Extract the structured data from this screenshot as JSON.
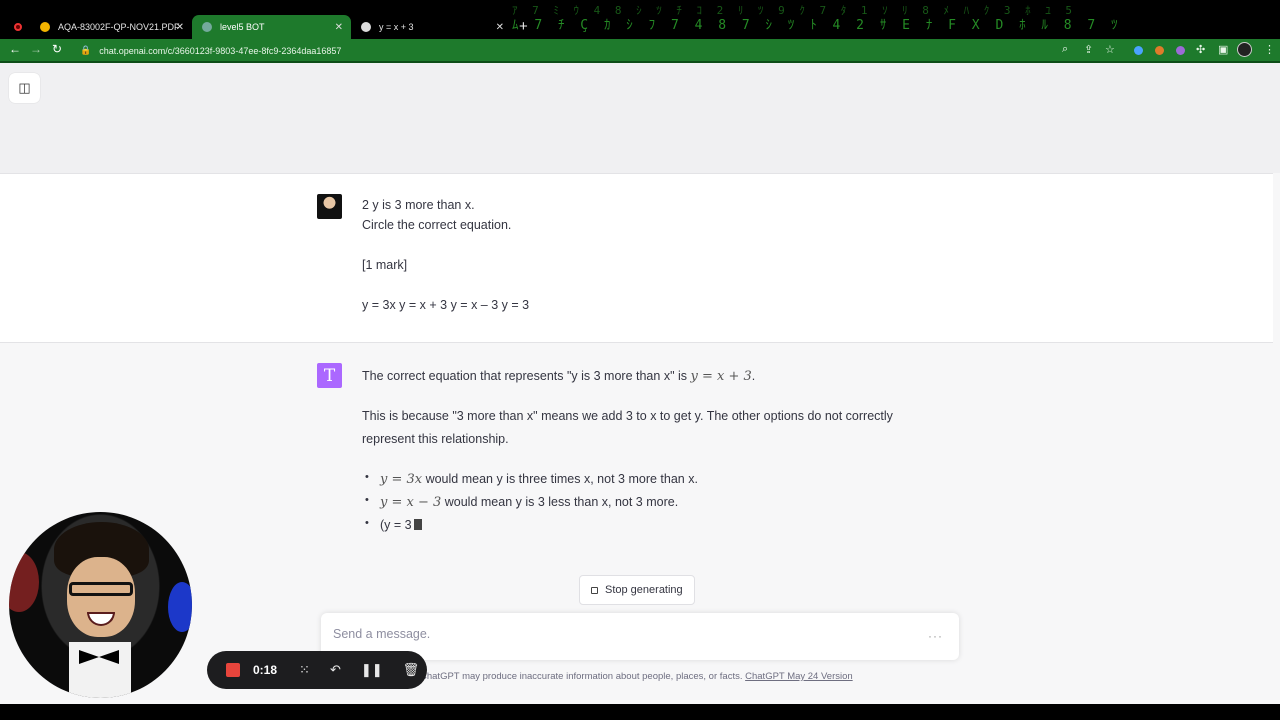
{
  "tabs": [
    {
      "label": "AQA-83002F-QP-NOV21.PDF",
      "active": false
    },
    {
      "label": "level5 BOT",
      "active": true
    },
    {
      "label": "y = x + 3",
      "active": false
    }
  ],
  "toolbar": {
    "url": "chat.openai.com/c/3660123f-9803-47ee-8fc9-2364daa16857"
  },
  "icons": {
    "back": "arrow-left-icon",
    "forward": "arrow-right-icon",
    "reload": "reload-icon",
    "sidebar_toggle": "sidebar-icon",
    "stop": "stop-square-icon"
  },
  "conversation": {
    "user_message": {
      "line1": "2 y is 3 more than x.",
      "line2": "Circle the correct equation.",
      "line3": "[1 mark]",
      "line4": "y = 3x y = x + 3 y = x – 3 y = 3"
    },
    "bot_message": {
      "avatar_letter": "T",
      "intro": "The correct equation that represents \"y is 3 more than x\" is",
      "intro_math": "y = x + 3",
      "explanation": "This is because \"3 more than x\" means we add 3 to x to get y. The other options do not correctly represent this relationship.",
      "bullets": [
        {
          "math": "y = 3x",
          "text": " would mean y is three times x, not 3 more than x."
        },
        {
          "math": "y = x − 3",
          "text": " would mean y is 3 less than x, not 3 more."
        },
        {
          "math": "",
          "text": "(y = 3"
        }
      ]
    }
  },
  "stop_button_label": "Stop generating",
  "composer": {
    "placeholder": "Send a message."
  },
  "footer": {
    "text": "ChatGPT may produce inaccurate information about people, places, or facts.",
    "link": "ChatGPT May 24 Version"
  },
  "recorder": {
    "time": "0:18"
  },
  "colors": {
    "tab_active": "#1e7a2c",
    "bot_avatar": "#ab68ff",
    "record_red": "#e8453c"
  }
}
